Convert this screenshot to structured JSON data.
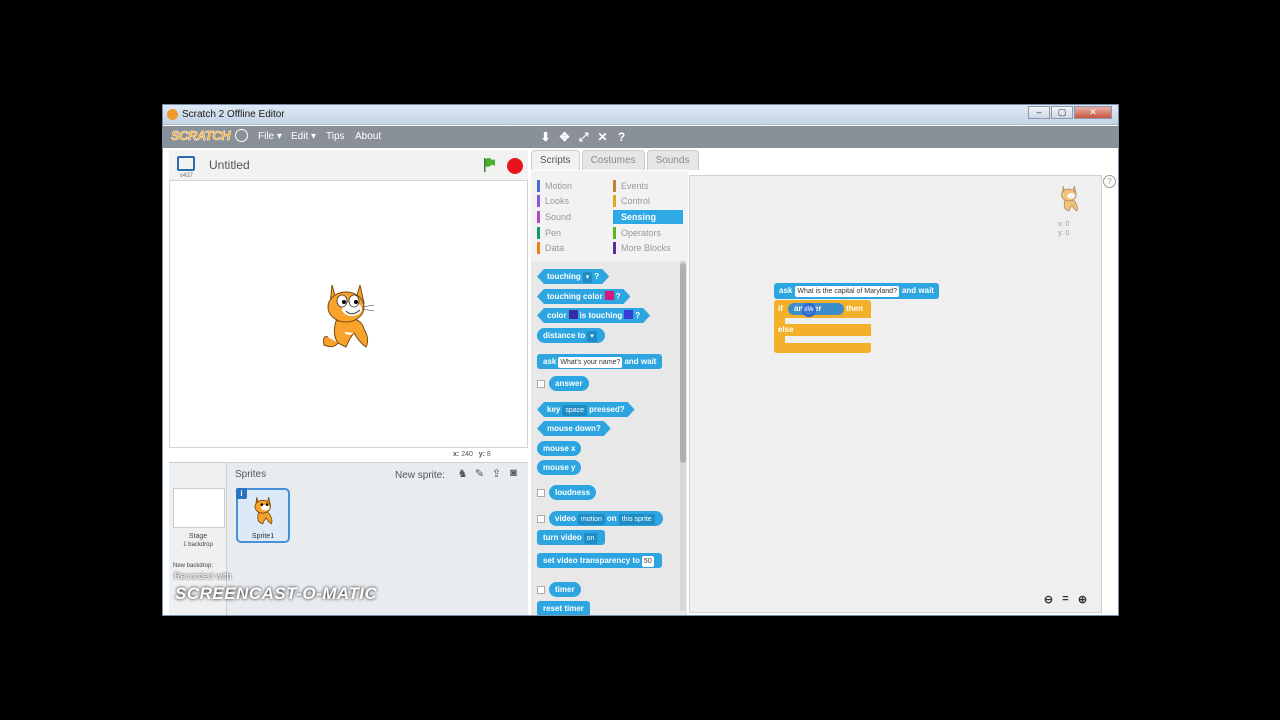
{
  "window": {
    "title": "Scratch 2 Offline Editor"
  },
  "menu": {
    "logo": "SCRATCH",
    "file": "File ▾",
    "edit": "Edit ▾",
    "tips": "Tips",
    "about": "About"
  },
  "stage": {
    "version": "v437",
    "project_title": "Untitled",
    "x_label": "x:",
    "x_value": "240",
    "y_label": "y:",
    "y_value": "8"
  },
  "tabs": [
    "Scripts",
    "Costumes",
    "Sounds"
  ],
  "categories": {
    "motion": "Motion",
    "looks": "Looks",
    "sound": "Sound",
    "pen": "Pen",
    "data": "Data",
    "events": "Events",
    "control": "Control",
    "sensing": "Sensing",
    "operators": "Operators",
    "more": "More Blocks"
  },
  "palette": {
    "touching": "touching",
    "touching_color": "touching color",
    "color": "color",
    "is_touching": "is touching",
    "distance_to": "distance to",
    "ask": "ask",
    "ask_input": "What's your name?",
    "and_wait": "and wait",
    "answer": "answer",
    "key": "key",
    "key_input": "space",
    "pressed": "pressed?",
    "mouse_down": "mouse down?",
    "mouse_x": "mouse x",
    "mouse_y": "mouse y",
    "loudness": "loudness",
    "video": "video",
    "video_motion": "motion",
    "video_on": "on",
    "video_target": "this sprite",
    "turn_video": "turn video",
    "turn_video_on": "on",
    "set_video_transparency": "set video transparency to",
    "transparency_value": "50",
    "timer": "timer",
    "reset_timer": "reset timer"
  },
  "sprites": {
    "label": "Sprites",
    "new_sprite": "New sprite:",
    "stage_label": "Stage",
    "backdrop_count": "1 backdrop",
    "new_backdrop": "New backdrop:",
    "sprite1": "Sprite1"
  },
  "script": {
    "ask": "ask",
    "ask_input": "What is the capital of Maryland?",
    "and_wait": "and wait",
    "if": "if",
    "condition": "answer",
    "then": "then",
    "else": "else",
    "x": "x: 0",
    "y": "y: 0"
  },
  "watermark": {
    "recorded": "Recorded with",
    "brand": "SCREENCAST-O-MATIC"
  },
  "colors": {
    "sensing": "#2ca5e0",
    "control": "#f2b02b",
    "motion": "#4a6cd4",
    "looks": "#8a55d7",
    "sound": "#bb42c3",
    "pen": "#0e9a6c",
    "data": "#ee7d16",
    "events": "#c88330",
    "operators": "#5cb712",
    "more_blocks": "#632d99"
  }
}
